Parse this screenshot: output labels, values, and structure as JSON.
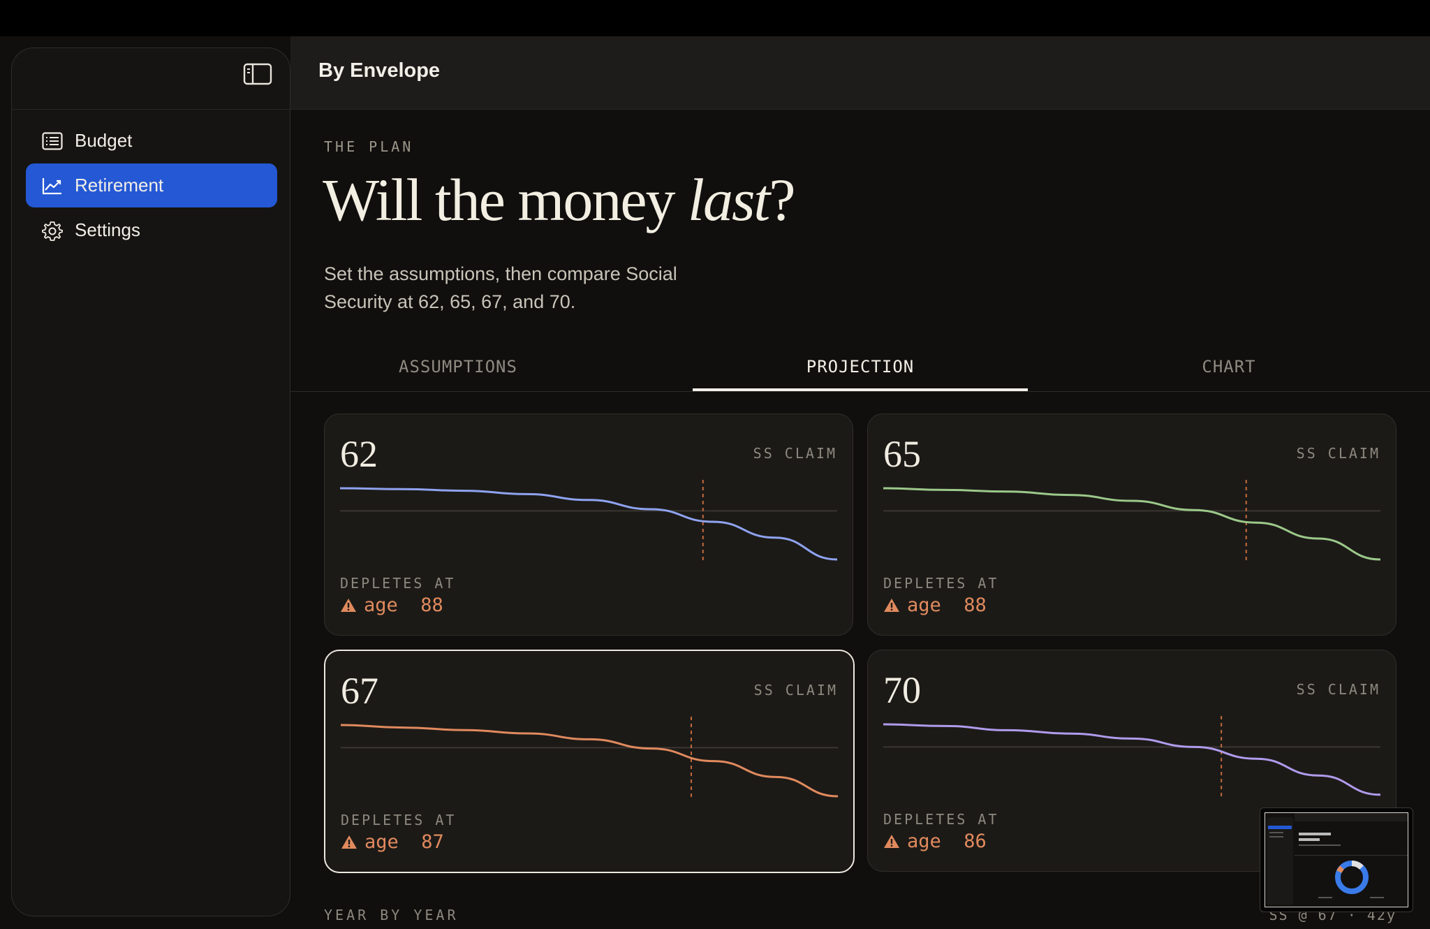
{
  "header": {
    "title": "By Envelope"
  },
  "sidebar": {
    "items": [
      {
        "label": "Budget",
        "icon": "budget-list-icon",
        "active": false
      },
      {
        "label": "Retirement",
        "icon": "chart-line-icon",
        "active": true
      },
      {
        "label": "Settings",
        "icon": "gear-icon",
        "active": false
      }
    ]
  },
  "hero": {
    "eyebrow": "THE PLAN",
    "title_pre": "Will the money ",
    "title_em": "last",
    "title_post": "?",
    "subtitle": "Set the assumptions, then compare Social Security at 62, 65, 67, and 70."
  },
  "tabs": [
    {
      "label": "ASSUMPTIONS",
      "active": false
    },
    {
      "label": "PROJECTION",
      "active": true
    },
    {
      "label": "CHART",
      "active": false
    }
  ],
  "cards": [
    {
      "age": "62",
      "claim_label": "SS CLAIM",
      "depletes_label": "DEPLETES AT",
      "depletes_value": "age  88",
      "color": "#8fa3f0",
      "selected": false,
      "marker": 0.73,
      "curve": [
        0.1,
        0.11,
        0.13,
        0.17,
        0.24,
        0.35,
        0.5,
        0.69,
        0.95
      ]
    },
    {
      "age": "65",
      "claim_label": "SS CLAIM",
      "depletes_label": "DEPLETES AT",
      "depletes_value": "age  88",
      "color": "#9cc98a",
      "selected": false,
      "marker": 0.73,
      "curve": [
        0.1,
        0.12,
        0.14,
        0.18,
        0.25,
        0.36,
        0.51,
        0.7,
        0.95
      ]
    },
    {
      "age": "67",
      "claim_label": "SS CLAIM",
      "depletes_label": "DEPLETES AT",
      "depletes_value": "age  87",
      "color": "#e08a5e",
      "selected": true,
      "marker": 0.705,
      "curve": [
        0.1,
        0.13,
        0.16,
        0.2,
        0.27,
        0.38,
        0.53,
        0.72,
        0.95
      ]
    },
    {
      "age": "70",
      "claim_label": "SS CLAIM",
      "depletes_label": "DEPLETES AT",
      "depletes_value": "age  86",
      "color": "#b09bec",
      "selected": false,
      "marker": 0.68,
      "curve": [
        0.1,
        0.12,
        0.17,
        0.21,
        0.27,
        0.37,
        0.51,
        0.71,
        0.94
      ]
    }
  ],
  "section": {
    "label": "YEAR BY YEAR",
    "meta": "SS @ 67 · 42y"
  },
  "colors": {
    "accent": "#2458d4",
    "warning": "#e08a5e",
    "background": "#100f0d"
  }
}
